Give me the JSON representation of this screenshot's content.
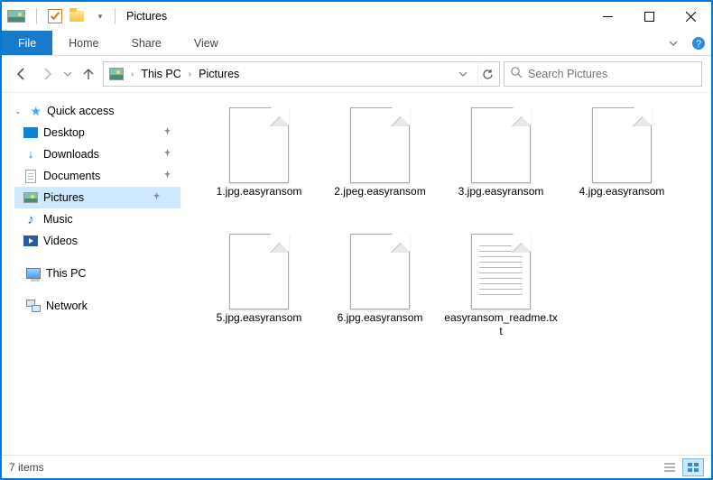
{
  "window": {
    "title": "Pictures"
  },
  "ribbon": {
    "file": "File",
    "tabs": [
      "Home",
      "Share",
      "View"
    ]
  },
  "breadcrumb": [
    "This PC",
    "Pictures"
  ],
  "search": {
    "placeholder": "Search Pictures"
  },
  "nav": {
    "quick_access": "Quick access",
    "items": [
      {
        "label": "Desktop",
        "pinned": true
      },
      {
        "label": "Downloads",
        "pinned": true
      },
      {
        "label": "Documents",
        "pinned": true
      },
      {
        "label": "Pictures",
        "pinned": true,
        "selected": true
      },
      {
        "label": "Music",
        "pinned": false
      },
      {
        "label": "Videos",
        "pinned": false
      }
    ],
    "this_pc": "This PC",
    "network": "Network"
  },
  "files": [
    {
      "name": "1.jpg.easyransom",
      "type": "blank"
    },
    {
      "name": "2.jpeg.easyransom",
      "type": "blank"
    },
    {
      "name": "3.jpg.easyransom",
      "type": "blank"
    },
    {
      "name": "4.jpg.easyransom",
      "type": "blank"
    },
    {
      "name": "5.jpg.easyransom",
      "type": "blank"
    },
    {
      "name": "6.jpg.easyransom",
      "type": "blank"
    },
    {
      "name": "easyransom_readme.txt",
      "type": "txt"
    }
  ],
  "status": {
    "count_label": "7 items"
  }
}
